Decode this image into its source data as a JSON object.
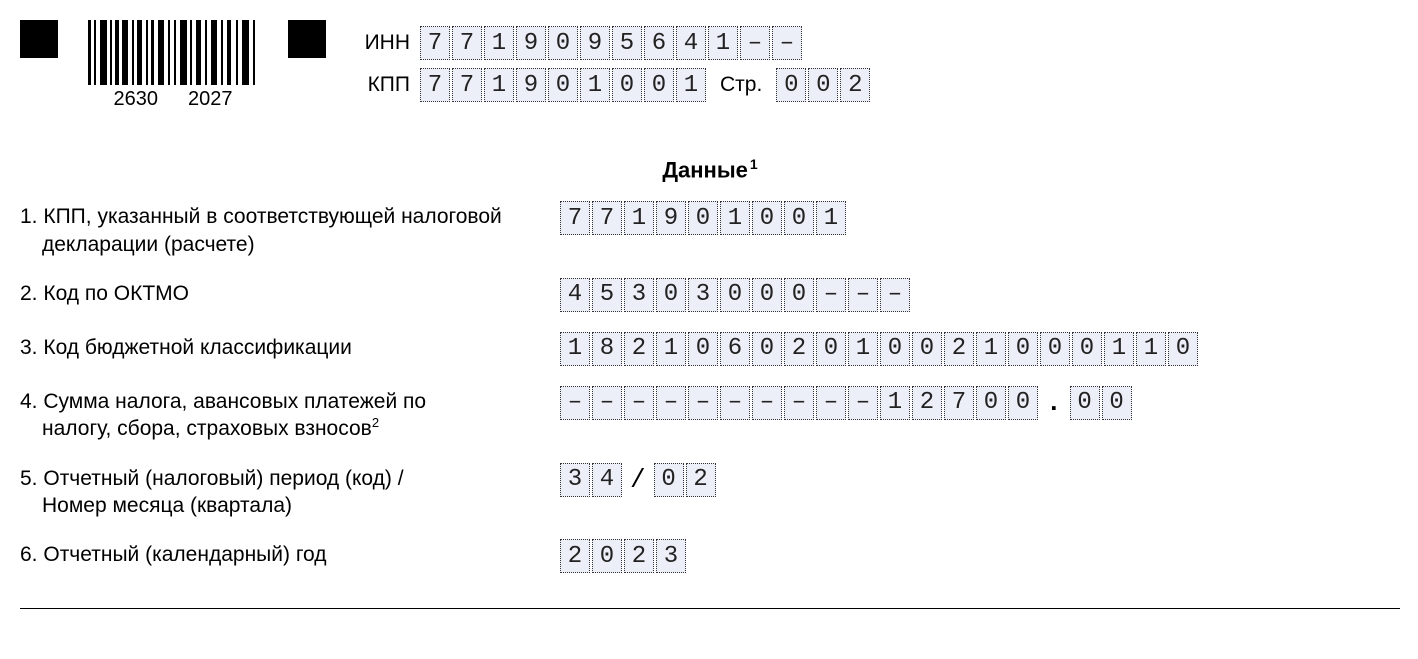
{
  "barcode": {
    "left": "2630",
    "right": "2027"
  },
  "header": {
    "inn_label": "ИНН",
    "inn": [
      "7",
      "7",
      "1",
      "9",
      "0",
      "9",
      "5",
      "6",
      "4",
      "1",
      "–",
      "–"
    ],
    "kpp_label": "КПП",
    "kpp": [
      "7",
      "7",
      "1",
      "9",
      "0",
      "1",
      "0",
      "0",
      "1"
    ],
    "page_label": "Стр.",
    "page": [
      "0",
      "0",
      "2"
    ]
  },
  "section_title": "Данные",
  "rows": [
    {
      "num": "1.",
      "label_line1": "КПП, указанный в соответствующей налоговой",
      "label_line2": "декларации (расчете)",
      "cells": [
        "7",
        "7",
        "1",
        "9",
        "0",
        "1",
        "0",
        "0",
        "1"
      ]
    },
    {
      "num": "2.",
      "label_line1": "Код по ОКТМО",
      "cells": [
        "4",
        "5",
        "3",
        "0",
        "3",
        "0",
        "0",
        "0",
        "–",
        "–",
        "–"
      ]
    },
    {
      "num": "3.",
      "label_line1": "Код бюджетной классификации",
      "cells": [
        "1",
        "8",
        "2",
        "1",
        "0",
        "6",
        "0",
        "2",
        "0",
        "1",
        "0",
        "0",
        "2",
        "1",
        "0",
        "0",
        "0",
        "1",
        "1",
        "0"
      ]
    },
    {
      "num": "4.",
      "label_line1": "Сумма налога, авансовых платежей по",
      "label_line2": "налогу, сбора, страховых взносов",
      "footnote": "2",
      "cells_int": [
        "–",
        "–",
        "–",
        "–",
        "–",
        "–",
        "–",
        "–",
        "–",
        "–",
        "1",
        "2",
        "7",
        "0",
        "0"
      ],
      "cells_dec": [
        "0",
        "0"
      ]
    },
    {
      "num": "5.",
      "label_line1": "Отчетный (налоговый) период (код) /",
      "label_line2": "Номер месяца (квартала)",
      "cells_a": [
        "3",
        "4"
      ],
      "cells_b": [
        "0",
        "2"
      ]
    },
    {
      "num": "6.",
      "label_line1": "Отчетный (календарный) год",
      "cells": [
        "2",
        "0",
        "2",
        "3"
      ]
    }
  ]
}
